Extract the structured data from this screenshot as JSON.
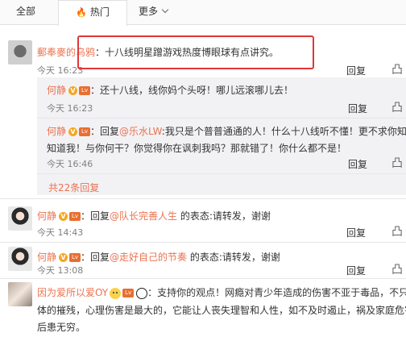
{
  "tabs": {
    "all": "全部",
    "hot": "热门",
    "more": "更多"
  },
  "comments": [
    {
      "user": "郵奉麥的乌鸦",
      "sep": "：",
      "text": "十八线明星蹭游戏热度博眼球有点讲究。",
      "time": "今天 16:23",
      "reply": "回复",
      "like": "凸"
    },
    {
      "user": "何静",
      "sep": "：",
      "text": "还十八线，线你妈个头呀！哪儿远滚哪儿去！",
      "time": "今天 16:23",
      "reply": "回复",
      "like": "凸"
    },
    {
      "user": "何静",
      "sep": "：",
      "reply_prefix": "回复",
      "mention": "@乐水LW",
      "text_a": ":我只是个普普通通的人！什么十八线听不懂！更不求你知道不",
      "text_b": "知道我！与你何干？你觉得你在讽刺我吗？那就错了！你什么都不是！",
      "time": "今天 16:46",
      "reply": "回复",
      "like": "凸"
    },
    {
      "user": "何静",
      "sep": "：",
      "reply_prefix": "回复",
      "mention": "@队长完善人生",
      "text": " 的表态:请转发，谢谢",
      "time": "今天 14:43",
      "reply": "回复",
      "like": "凸"
    },
    {
      "user": "何静",
      "sep": "：",
      "reply_prefix": "回复",
      "mention": "@走好自己的节奏",
      "text": " 的表态:请转发，谢谢",
      "time": "今天 13:08",
      "reply": "回复",
      "like": "凸"
    },
    {
      "user": "因为爱所以爱OY",
      "sep": "：",
      "text_a": "支持你的观点！网瘾对青少年造成的伤害不亚于毒品，不只是对身",
      "text_b": "体的摧残，心理伤害是最大的，它能让人丧失理智和人性，如不及时遏止，祸及家庭危害社会，",
      "text_c": "后患无穷。"
    }
  ],
  "more_replies": "共22条回复",
  "colors": {
    "link": "#eb7350",
    "highlight_border": "#e2363a",
    "subbox_bg": "#f2f2f5"
  }
}
